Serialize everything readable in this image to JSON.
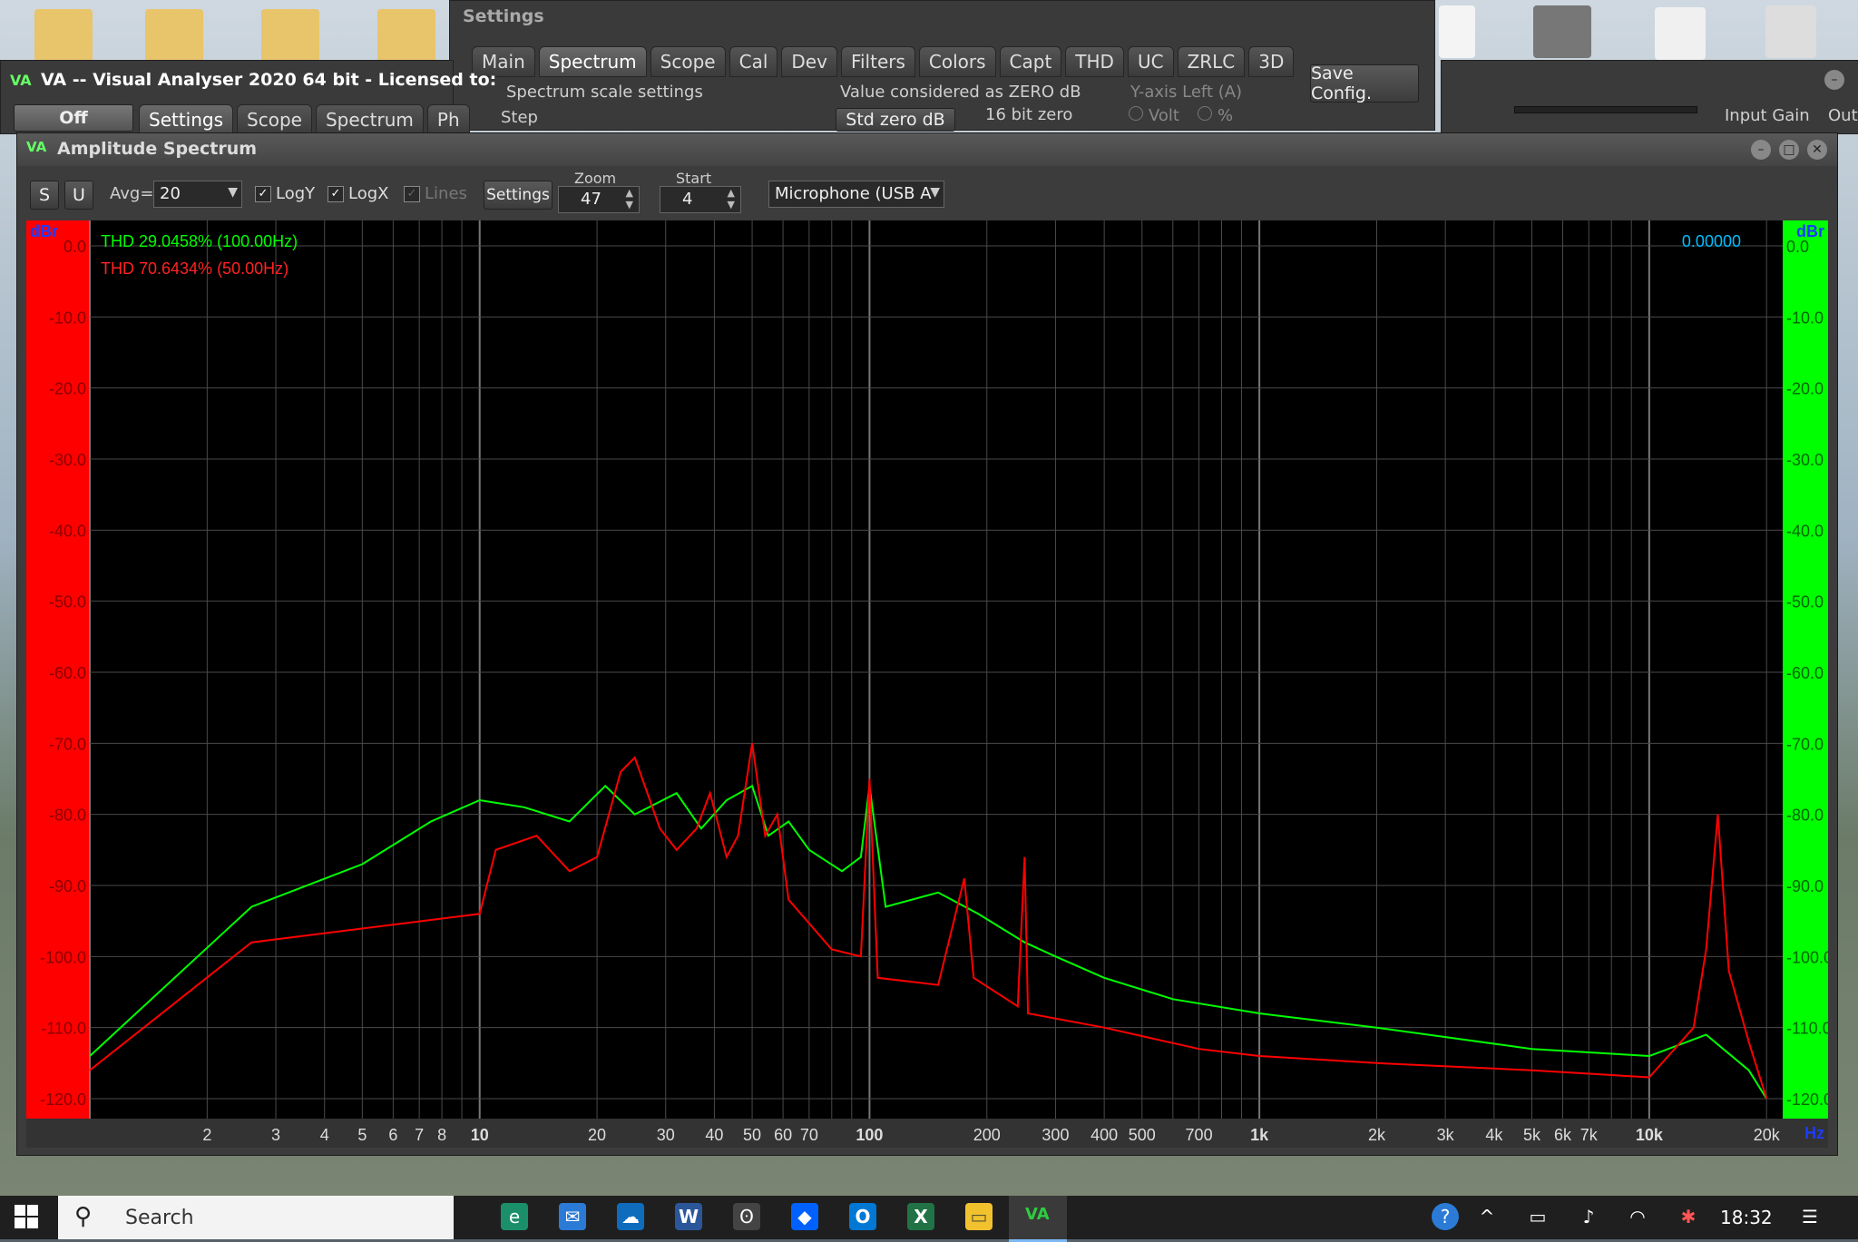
{
  "settings_window": {
    "title": "Settings",
    "tabs": [
      "Main",
      "Spectrum",
      "Scope",
      "Cal",
      "Dev",
      "Filters",
      "Colors",
      "Capt",
      "THD",
      "UC",
      "ZRLC",
      "3D"
    ],
    "active_tab": "Spectrum",
    "group_scale": "Spectrum scale settings",
    "step_label": "Step",
    "group_zero": "Value considered as ZERO dB",
    "std_zero": "Std zero dB",
    "bit_zero": "16 bit zero",
    "group_yaxis": "Y-axis Left (A)",
    "volt": "Volt",
    "pct": "%",
    "save_config": "Save Config."
  },
  "main_window": {
    "title": "VA -- Visual Analyser 2020 64 bit - Licensed to:",
    "off": "Off",
    "tabs": [
      "Settings",
      "Scope",
      "Spectrum",
      "Ph"
    ],
    "input_gain": "Input Gain",
    "out": "Out"
  },
  "spectrum_window": {
    "title": "Amplitude Spectrum",
    "s": "S",
    "u": "U",
    "avg_label": "Avg=",
    "avg_value": "20",
    "logy": "LogY",
    "logx": "LogX",
    "lines": "Lines",
    "settings": "Settings",
    "zoom_label": "Zoom",
    "zoom_value": "47",
    "start_label": "Start",
    "start_value": "4",
    "device": "Microphone (USB A"
  },
  "chart_data": {
    "type": "line",
    "left_unit": "dBr",
    "right_unit": "dBr",
    "x_unit": "Hz",
    "xscale": "log",
    "xlim": [
      1,
      22000
    ],
    "ylim": [
      -120,
      0
    ],
    "y_ticks": [
      "0.0",
      "-10.0",
      "-20.0",
      "-30.0",
      "-40.0",
      "-50.0",
      "-60.0",
      "-70.0",
      "-80.0",
      "-90.0",
      "-100.0",
      "-110.0",
      "-120.0"
    ],
    "x_ticks": [
      {
        "v": 2,
        "t": "2"
      },
      {
        "v": 3,
        "t": "3"
      },
      {
        "v": 4,
        "t": "4"
      },
      {
        "v": 5,
        "t": "5"
      },
      {
        "v": 6,
        "t": "6"
      },
      {
        "v": 7,
        "t": "7"
      },
      {
        "v": 8,
        "t": "8"
      },
      {
        "v": 10,
        "t": "10",
        "bold": true
      },
      {
        "v": 20,
        "t": "20"
      },
      {
        "v": 30,
        "t": "30"
      },
      {
        "v": 40,
        "t": "40"
      },
      {
        "v": 50,
        "t": "50"
      },
      {
        "v": 60,
        "t": "60"
      },
      {
        "v": 70,
        "t": "70"
      },
      {
        "v": 100,
        "t": "100",
        "bold": true
      },
      {
        "v": 200,
        "t": "200"
      },
      {
        "v": 300,
        "t": "300"
      },
      {
        "v": 400,
        "t": "400"
      },
      {
        "v": 500,
        "t": "500"
      },
      {
        "v": 700,
        "t": "700"
      },
      {
        "v": 1000,
        "t": "1k",
        "bold": true
      },
      {
        "v": 2000,
        "t": "2k"
      },
      {
        "v": 3000,
        "t": "3k"
      },
      {
        "v": 4000,
        "t": "4k"
      },
      {
        "v": 5000,
        "t": "5k"
      },
      {
        "v": 6000,
        "t": "6k"
      },
      {
        "v": 7000,
        "t": "7k"
      },
      {
        "v": 10000,
        "t": "10k",
        "bold": true
      },
      {
        "v": 20000,
        "t": "20k"
      }
    ],
    "annotations": {
      "thd_green": "THD 29.0458% (100.00Hz)",
      "thd_red": "THD 70.6434% (50.00Hz)",
      "readout": "0.00000"
    },
    "series": [
      {
        "color": "#00ff00",
        "points": [
          [
            1,
            -114
          ],
          [
            2.6,
            -93
          ],
          [
            5,
            -87
          ],
          [
            7.5,
            -81
          ],
          [
            10,
            -78
          ],
          [
            13,
            -79
          ],
          [
            17,
            -81
          ],
          [
            21,
            -76
          ],
          [
            25,
            -80
          ],
          [
            32,
            -77
          ],
          [
            37,
            -82
          ],
          [
            43,
            -78
          ],
          [
            50,
            -76
          ],
          [
            55,
            -83
          ],
          [
            62,
            -81
          ],
          [
            70,
            -85
          ],
          [
            85,
            -88
          ],
          [
            95,
            -86
          ],
          [
            100,
            -76
          ],
          [
            110,
            -93
          ],
          [
            150,
            -91
          ],
          [
            190,
            -94
          ],
          [
            250,
            -98
          ],
          [
            300,
            -100
          ],
          [
            400,
            -103
          ],
          [
            600,
            -106
          ],
          [
            1000,
            -108
          ],
          [
            2000,
            -110
          ],
          [
            5000,
            -113
          ],
          [
            10000,
            -114
          ],
          [
            14000,
            -111
          ],
          [
            18000,
            -116
          ],
          [
            20000,
            -120
          ]
        ]
      },
      {
        "color": "#ff0000",
        "points": [
          [
            1,
            -116
          ],
          [
            2.6,
            -98
          ],
          [
            10,
            -94
          ],
          [
            11,
            -85
          ],
          [
            14,
            -83
          ],
          [
            17,
            -88
          ],
          [
            20,
            -86
          ],
          [
            23,
            -74
          ],
          [
            25,
            -72
          ],
          [
            29,
            -82
          ],
          [
            32,
            -85
          ],
          [
            36,
            -82
          ],
          [
            39,
            -77
          ],
          [
            43,
            -86
          ],
          [
            46,
            -83
          ],
          [
            50,
            -70
          ],
          [
            54,
            -83
          ],
          [
            58,
            -80
          ],
          [
            62,
            -92
          ],
          [
            80,
            -99
          ],
          [
            95,
            -100
          ],
          [
            100,
            -75
          ],
          [
            105,
            -103
          ],
          [
            150,
            -104
          ],
          [
            175,
            -89
          ],
          [
            185,
            -103
          ],
          [
            240,
            -107
          ],
          [
            250,
            -86
          ],
          [
            255,
            -108
          ],
          [
            400,
            -110
          ],
          [
            700,
            -113
          ],
          [
            1000,
            -114
          ],
          [
            2000,
            -115
          ],
          [
            5000,
            -116
          ],
          [
            10000,
            -117
          ],
          [
            13000,
            -110
          ],
          [
            14000,
            -99
          ],
          [
            15000,
            -80
          ],
          [
            16000,
            -102
          ],
          [
            18000,
            -112
          ],
          [
            20000,
            -120
          ]
        ]
      }
    ]
  },
  "taskbar": {
    "search": "Search",
    "time": "18:32"
  }
}
